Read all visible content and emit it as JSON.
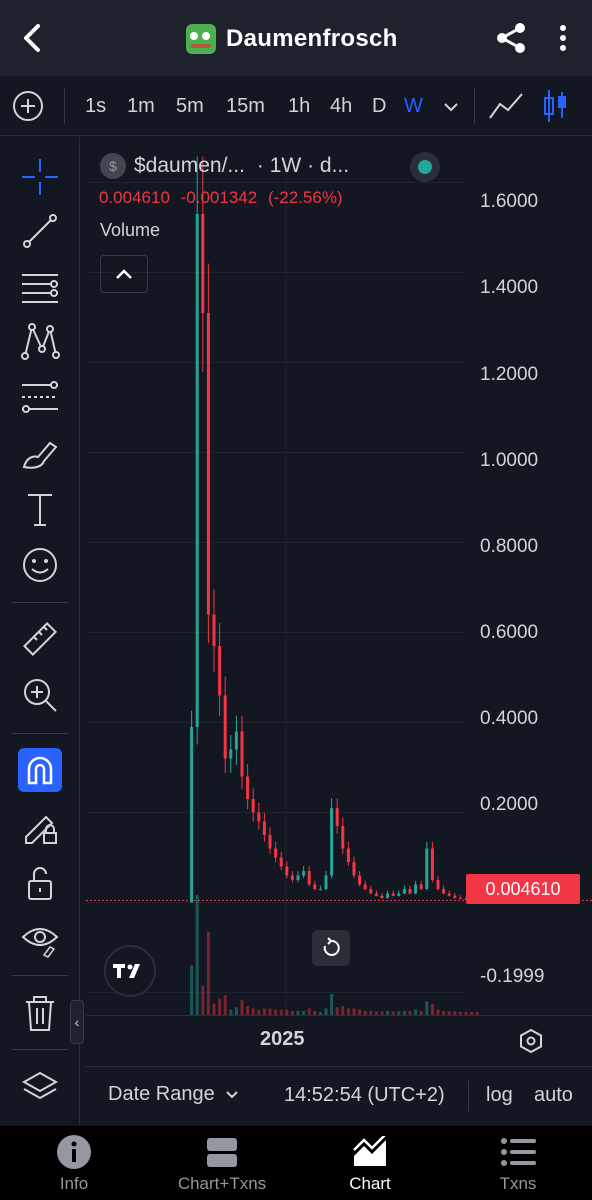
{
  "header": {
    "title": "Daumenfrosch"
  },
  "timeframes": [
    "1s",
    "1m",
    "5m",
    "15m",
    "1h",
    "4h",
    "D",
    "W"
  ],
  "active_timeframe": "W",
  "legend": {
    "coin_icon": "$",
    "symbol": "$daumen/...",
    "interval": "· 1W · d...",
    "close": "0.004610",
    "change": "-0.001342",
    "change_pct": "(-22.56%)",
    "volume_label": "Volume"
  },
  "colors": {
    "up": "#26a69a",
    "down": "#f23645",
    "accent": "#2962ff"
  },
  "chart_data": {
    "type": "candlestick",
    "x_tick_labels": [
      "2025"
    ],
    "y_tick_labels": [
      "1.6000",
      "1.4000",
      "1.2000",
      "1.0000",
      "0.8000",
      "0.6000",
      "0.4000",
      "0.2000",
      "-0.1999"
    ],
    "ylim": [
      -0.25,
      1.65
    ],
    "last_price_label": "0.004610",
    "series": [
      {
        "values": [
          0.0,
          0.39,
          1.53,
          1.31,
          0.64,
          0.57,
          0.46,
          0.32,
          0.34,
          0.38,
          0.28,
          0.23,
          0.2,
          0.18,
          0.15,
          0.12,
          0.1,
          0.08,
          0.06,
          0.05,
          0.06,
          0.07,
          0.04,
          0.03,
          0.03,
          0.06,
          0.21,
          0.17,
          0.12,
          0.09,
          0.06,
          0.04,
          0.03,
          0.02,
          0.015,
          0.01,
          0.02,
          0.015,
          0.02,
          0.03,
          0.02,
          0.04,
          0.03,
          0.12,
          0.05,
          0.03,
          0.02,
          0.015,
          0.01,
          0.008,
          0.006,
          0.005,
          0.0046
        ]
      }
    ],
    "grid": true
  },
  "axis": {
    "x_label_2025": "2025"
  },
  "controls": {
    "date_range": "Date Range",
    "clock": "14:52:54 (UTC+2)",
    "log": "log",
    "auto": "auto"
  },
  "nav": [
    {
      "label": "Info",
      "icon": "info-icon"
    },
    {
      "label": "Chart+Txns",
      "icon": "split-view-icon"
    },
    {
      "label": "Chart",
      "icon": "chart-icon"
    },
    {
      "label": "Txns",
      "icon": "list-icon"
    }
  ]
}
